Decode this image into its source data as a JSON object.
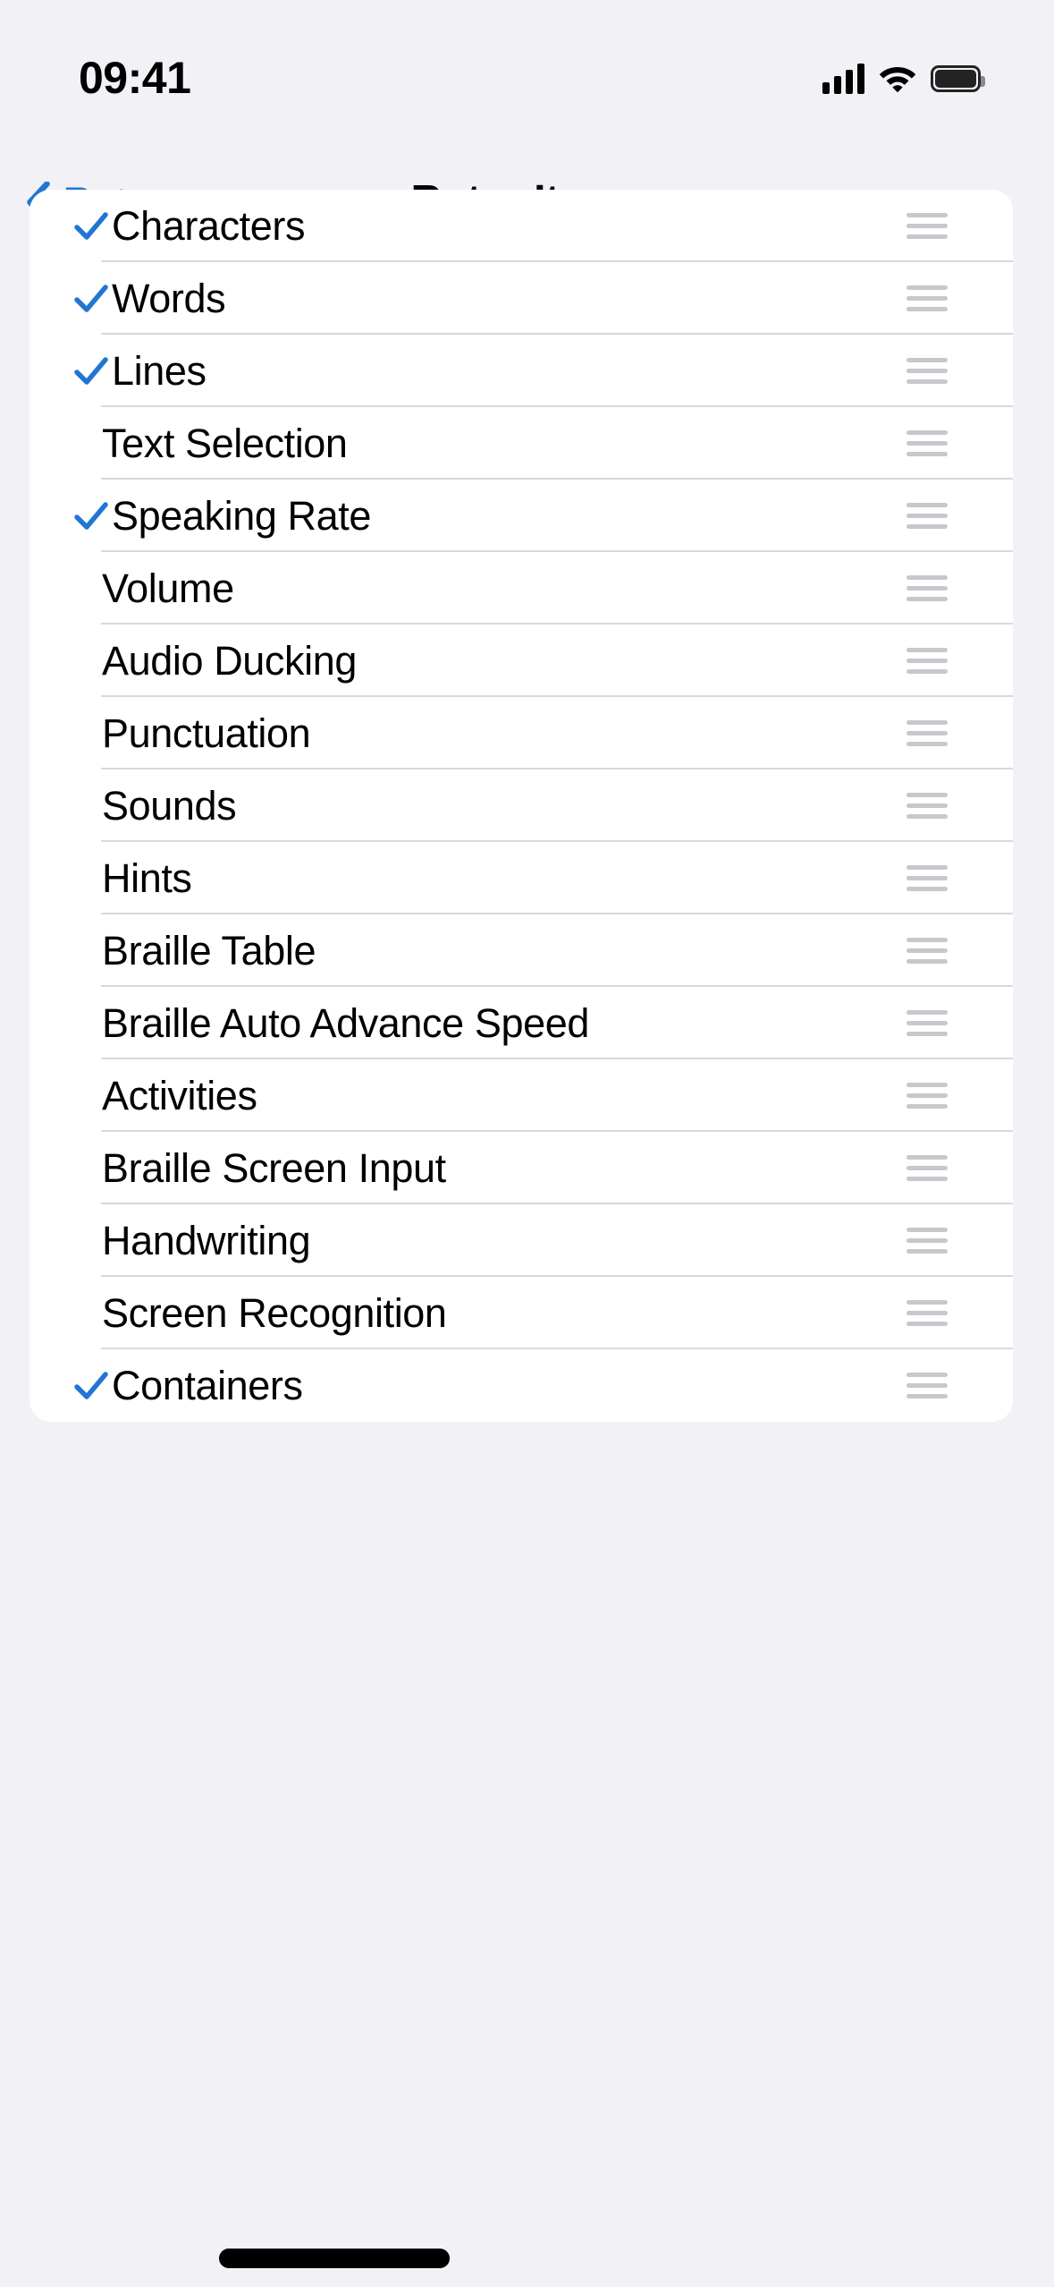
{
  "status_bar": {
    "time": "09:41",
    "cellular_icon": "cellular-bars-icon",
    "wifi_icon": "wifi-icon",
    "battery_icon": "battery-full-icon"
  },
  "nav": {
    "back_label": "Rotor",
    "back_icon": "chevron-left-icon",
    "title": "Rotor Items"
  },
  "colors": {
    "accent": "#2176d2",
    "background": "#f2f1f6",
    "card": "#ffffff",
    "separator": "#d8d8dc",
    "handle": "#c8c7cc",
    "label": "#000000"
  },
  "list": {
    "reorder_icon": "reorder-handle-icon",
    "check_icon": "checkmark-icon",
    "items": [
      {
        "label": "Characters",
        "checked": true
      },
      {
        "label": "Words",
        "checked": true
      },
      {
        "label": "Lines",
        "checked": true
      },
      {
        "label": "Text Selection",
        "checked": false
      },
      {
        "label": "Speaking Rate",
        "checked": true
      },
      {
        "label": "Volume",
        "checked": false
      },
      {
        "label": "Audio Ducking",
        "checked": false
      },
      {
        "label": "Punctuation",
        "checked": false
      },
      {
        "label": "Sounds",
        "checked": false
      },
      {
        "label": "Hints",
        "checked": false
      },
      {
        "label": "Braille Table",
        "checked": false
      },
      {
        "label": "Braille Auto Advance Speed",
        "checked": false
      },
      {
        "label": "Activities",
        "checked": false
      },
      {
        "label": "Braille Screen Input",
        "checked": false
      },
      {
        "label": "Handwriting",
        "checked": false
      },
      {
        "label": "Screen Recognition",
        "checked": false
      },
      {
        "label": "Containers",
        "checked": true
      }
    ]
  }
}
